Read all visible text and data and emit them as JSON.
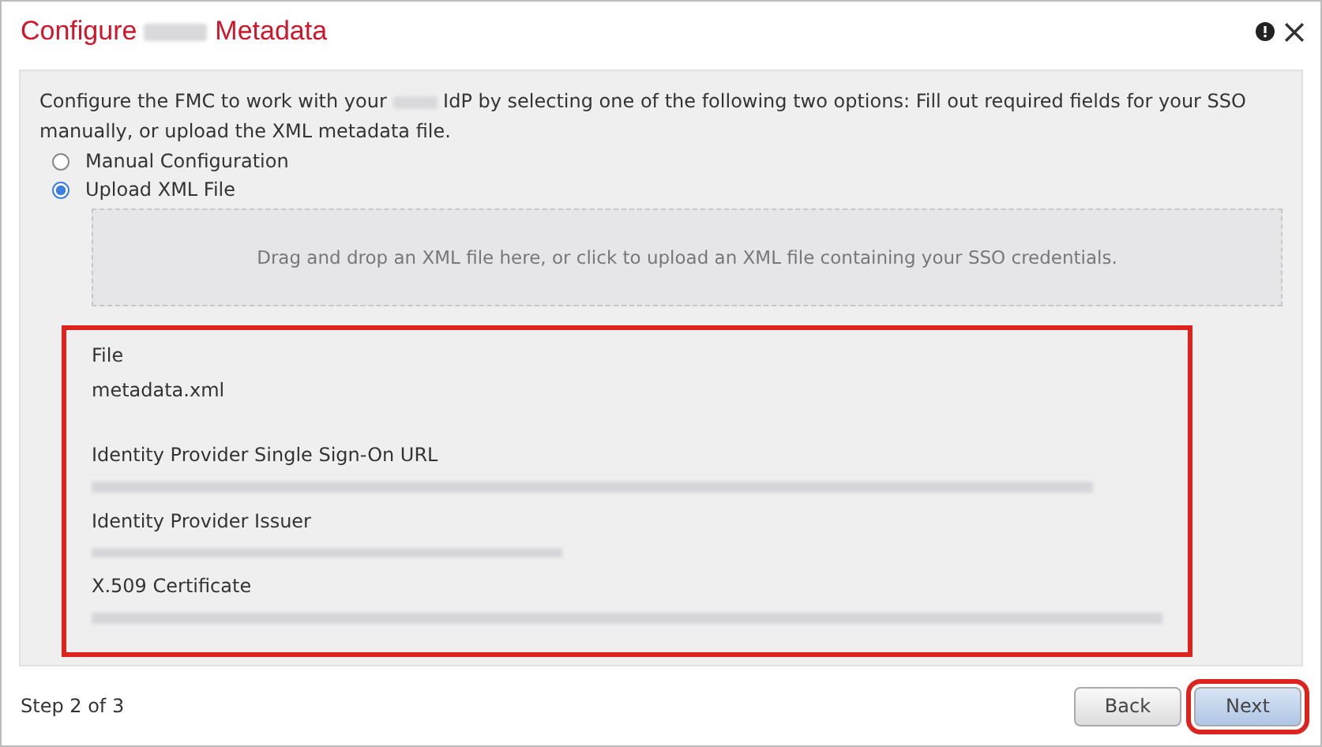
{
  "dialog": {
    "title_before": "Configure",
    "title_redacted": true,
    "title_after": "Metadata"
  },
  "intro": {
    "before": "Configure the FMC to work with your",
    "redacted": true,
    "after": "IdP by selecting one of the following two options: Fill out required fields for your SSO manually, or upload the XML metadata file."
  },
  "options": [
    {
      "label": "Manual Configuration",
      "selected": false
    },
    {
      "label": "Upload XML File",
      "selected": true
    }
  ],
  "drop_zone": {
    "text": "Drag and drop an XML file here, or click to upload an XML file containing your SSO credentials."
  },
  "details": {
    "highlighted": true,
    "fields": [
      {
        "label": "File",
        "value": "metadata.xml",
        "redacted": false
      },
      {
        "label": "Identity Provider Single Sign-On URL",
        "redacted": true
      },
      {
        "label": "Identity Provider Issuer",
        "redacted": true
      },
      {
        "label": "X.509 Certificate",
        "redacted": true
      }
    ]
  },
  "footer": {
    "step": "Step 2 of 3",
    "buttons": [
      {
        "label": "Back",
        "highlighted": false
      },
      {
        "label": "Next",
        "highlighted": true
      }
    ]
  }
}
